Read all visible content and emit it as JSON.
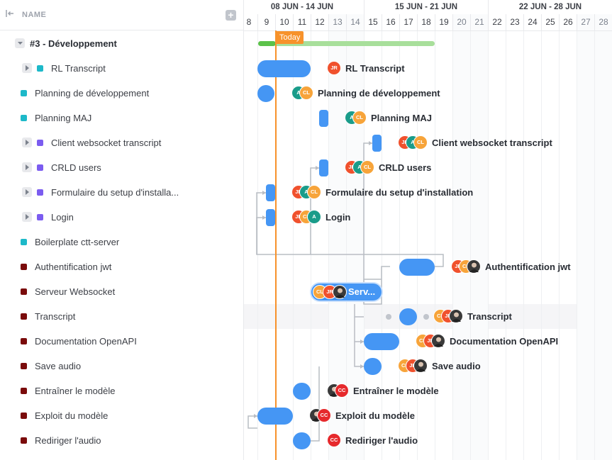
{
  "header": {
    "name_column": "NAME",
    "weeks": [
      "08 JUN - 14 JUN",
      "15 JUN - 21 JUN",
      "22 JUN - 28 JUN"
    ],
    "days": [
      "8",
      "9",
      "10",
      "11",
      "12",
      "13",
      "14",
      "15",
      "16",
      "17",
      "18",
      "19",
      "20",
      "21",
      "22",
      "23",
      "24",
      "25",
      "26",
      "27",
      "28"
    ],
    "today_label": "Today"
  },
  "group": {
    "name": "#3 - Développement"
  },
  "tasks": [
    {
      "name": "RL Transcript",
      "status_color": "#1db9c9",
      "expandable": true,
      "label": "RL Transcript",
      "avatars": [
        "JR"
      ]
    },
    {
      "name": "Planning de développement",
      "status_color": "#1db9c9",
      "expandable": false,
      "label": "Planning de développement",
      "avatars": [
        "A",
        "CL"
      ]
    },
    {
      "name": "Planning MAJ",
      "status_color": "#1db9c9",
      "expandable": false,
      "label": "Planning MAJ",
      "avatars": [
        "A",
        "CL"
      ]
    },
    {
      "name": "Client websocket transcript",
      "status_color": "#7b5cf0",
      "expandable": true,
      "label": "Client websocket transcript",
      "avatars": [
        "JR",
        "A",
        "CL"
      ]
    },
    {
      "name": "CRLD users",
      "status_color": "#7b5cf0",
      "expandable": true,
      "label": "CRLD users",
      "avatars": [
        "JR",
        "A",
        "CL"
      ]
    },
    {
      "name": "Formulaire du setup d'installa...",
      "status_color": "#7b5cf0",
      "expandable": true,
      "label": "Formulaire du setup d'installation",
      "avatars": [
        "JR",
        "A",
        "CL"
      ]
    },
    {
      "name": "Login",
      "status_color": "#7b5cf0",
      "expandable": true,
      "label": "Login",
      "avatars": [
        "JR",
        "CL",
        "A"
      ]
    },
    {
      "name": "Boilerplate ctt-server",
      "status_color": "#1db9c9",
      "expandable": false,
      "label": "",
      "avatars": []
    },
    {
      "name": "Authentification jwt",
      "status_color": "#7a0b0b",
      "expandable": false,
      "label": "Authentification jwt",
      "avatars": [
        "JR",
        "CL",
        "photo"
      ]
    },
    {
      "name": "Serveur Websocket",
      "status_color": "#7a0b0b",
      "expandable": false,
      "label": "Serv...",
      "avatars": [
        "CL",
        "JR",
        "photo"
      ]
    },
    {
      "name": "Transcript",
      "status_color": "#7a0b0b",
      "expandable": false,
      "label": "Transcript",
      "avatars": [
        "CL",
        "JR",
        "photo"
      ]
    },
    {
      "name": "Documentation OpenAPI",
      "status_color": "#7a0b0b",
      "expandable": false,
      "label": "Documentation OpenAPI",
      "avatars": [
        "CL",
        "JR",
        "photo"
      ]
    },
    {
      "name": "Save audio",
      "status_color": "#7a0b0b",
      "expandable": false,
      "label": "Save audio",
      "avatars": [
        "CL",
        "JR",
        "photo"
      ]
    },
    {
      "name": "Entraîner le modèle",
      "status_color": "#7a0b0b",
      "expandable": false,
      "label": "Entraîner le modèle",
      "avatars": [
        "photo",
        "CC"
      ]
    },
    {
      "name": "Exploit du modèle",
      "status_color": "#7a0b0b",
      "expandable": false,
      "label": "Exploit du modèle",
      "avatars": [
        "photo",
        "CC"
      ]
    },
    {
      "name": "Rediriger l'audio",
      "status_color": "#7a0b0b",
      "expandable": false,
      "label": "Rediriger l'audio",
      "avatars": [
        "CC"
      ]
    }
  ],
  "colors": {
    "bar": "#4596f4",
    "today": "#f7922b",
    "group_progress_done": "#5cc24a",
    "group_progress_rest": "#a8df9b",
    "connector": "#b9bdc4"
  }
}
